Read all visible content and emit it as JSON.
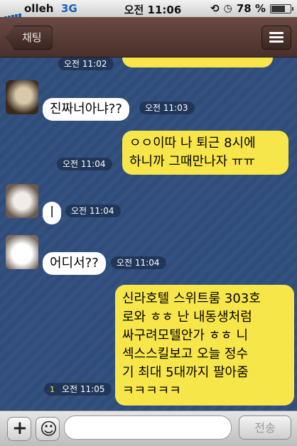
{
  "status_bar": {
    "carrier": "olleh",
    "network": "3G",
    "time": "오전 11:06",
    "battery": "78 %",
    "battery_fraction": 0.78
  },
  "nav": {
    "back_label": "채팅",
    "title": ""
  },
  "messages": [
    {
      "time": "오전 11:02"
    },
    {
      "sender": "",
      "text": "진짜너아냐??",
      "time": "오전 11:03"
    },
    {
      "text_lines": [
        "ㅇㅇ이따 나 퇴근 8시에",
        "하니까 그때만나자 ㅠㅠ"
      ],
      "time": "오전 11:04"
    },
    {
      "sender": "",
      "text": "ㅣ",
      "time": "오전 11:04"
    },
    {
      "sender": "",
      "text": "어디서??",
      "time": "오전 11:04"
    },
    {
      "text_lines": [
        "신라호텔 스위트룸 303호",
        "로와 ㅎㅎ 난 내동생처럼",
        "싸구려모텔안가 ㅎㅎ 니",
        "섹스스킬보고 오늘 정수",
        "기 최대 5대까지 팔아줌",
        "ㅋㅋㅋㅋㅋ"
      ],
      "time": "오전 11:05",
      "unread": "1"
    }
  ],
  "input": {
    "placeholder": "",
    "send_label": "전송"
  }
}
